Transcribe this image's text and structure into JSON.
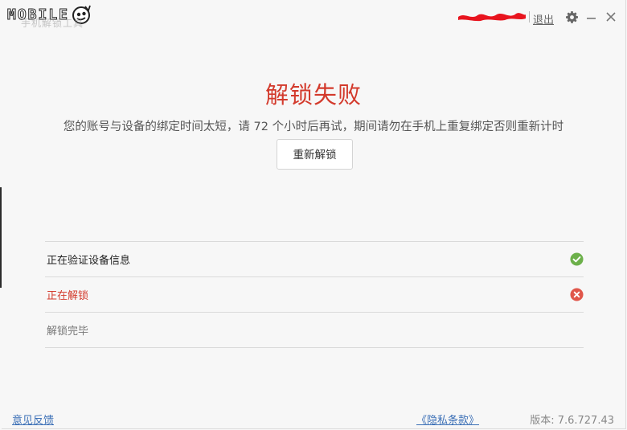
{
  "titlebar": {
    "logo_text": "MOBILE",
    "logo_sub": "手机解锁工具",
    "logout_label": "退出"
  },
  "main": {
    "title": "解锁失败",
    "description": "您的账号与设备的绑定时间太短，请 72 个小时后再试，期间请勿在手机上重复绑定否则重新计时",
    "relock_button": "重新解锁"
  },
  "steps": [
    {
      "label": "正在验证设备信息",
      "status": "done",
      "icon": "check-circle-icon"
    },
    {
      "label": "正在解锁",
      "status": "error",
      "icon": "error-circle-icon"
    },
    {
      "label": "解锁完毕",
      "status": "pending"
    }
  ],
  "footer": {
    "feedback_label": "意见反馈",
    "privacy_label": "《隐私条款》",
    "version_label": "版本: 7.6.727.43"
  },
  "colors": {
    "error": "#d33a2c",
    "success": "#6cb04a",
    "link": "#3b6fb6"
  }
}
